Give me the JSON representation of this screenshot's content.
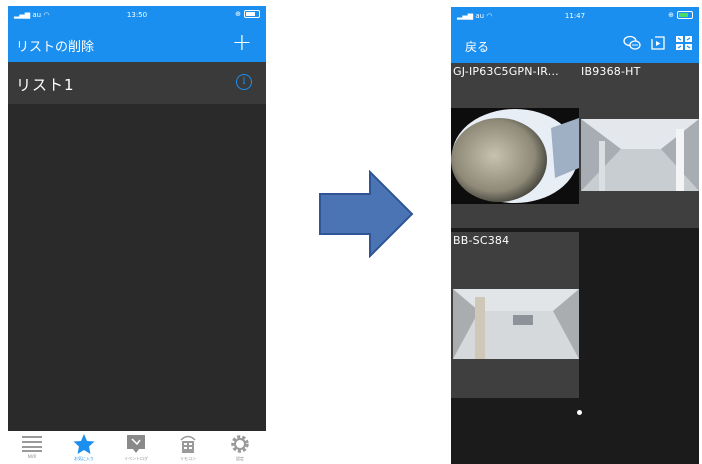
{
  "phone1": {
    "status": {
      "carrier": "au",
      "time": "13:50"
    },
    "nav": {
      "title": "リストの削除",
      "add_symbol": "+"
    },
    "list": [
      {
        "label": "リスト1",
        "info_symbol": "i"
      }
    ],
    "tabs": [
      {
        "icon": "list-icon",
        "label": "NVR",
        "active": false
      },
      {
        "icon": "star-icon",
        "label": "お気に入り",
        "active": true
      },
      {
        "icon": "event-log-icon",
        "label": "イベントログ",
        "active": false
      },
      {
        "icon": "remote-icon",
        "label": "リモコン",
        "active": false
      },
      {
        "icon": "gear-icon",
        "label": "設定",
        "active": false
      }
    ]
  },
  "phone2": {
    "status": {
      "carrier": "au",
      "time": "11:47"
    },
    "nav": {
      "back_label": "戻る"
    },
    "cameras": [
      {
        "name": "GJ-IP63C5GPN-IR...",
        "timestamp": ""
      },
      {
        "name": "IB9368-HT",
        "timestamp": ""
      },
      {
        "name": "BB-SC384",
        "timestamp": ""
      }
    ]
  },
  "colors": {
    "accent": "#1a8ff0",
    "arrow_fill": "#4a74b4",
    "arrow_stroke": "#2f5597"
  }
}
